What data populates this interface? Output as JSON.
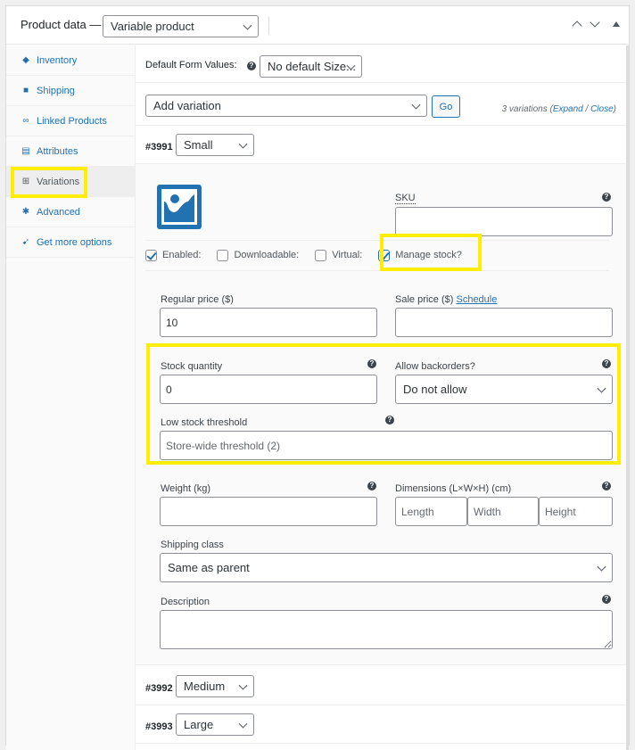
{
  "header": {
    "title": "Product data —",
    "product_type": "Variable product"
  },
  "sidebar": {
    "items": [
      {
        "label": "Inventory",
        "icon": "tag-icon"
      },
      {
        "label": "Shipping",
        "icon": "truck-icon"
      },
      {
        "label": "Linked Products",
        "icon": "link-icon"
      },
      {
        "label": "Attributes",
        "icon": "list-icon"
      },
      {
        "label": "Variations",
        "icon": "grid-icon",
        "active": true
      },
      {
        "label": "Advanced",
        "icon": "gear-icon"
      },
      {
        "label": "Get more options",
        "icon": "plugin-icon"
      }
    ]
  },
  "main": {
    "default_form_label": "Default Form Values:",
    "default_form_value": "No default Size...",
    "add_variation": "Add variation",
    "go_label": "Go",
    "variation_count": "3 variations",
    "expand_label": "Expand",
    "close_label": "Close",
    "variations": [
      {
        "id": "#3991",
        "value": "Small"
      },
      {
        "id": "#3992",
        "value": "Medium"
      },
      {
        "id": "#3993",
        "value": "Large"
      }
    ],
    "form": {
      "sku_label": "SKU",
      "sku_value": "",
      "enabled_label": "Enabled:",
      "enabled": true,
      "downloadable_label": "Downloadable:",
      "downloadable": false,
      "virtual_label": "Virtual:",
      "virtual": false,
      "manage_stock_label": "Manage stock?",
      "manage_stock": true,
      "regular_price_label": "Regular price ($)",
      "regular_price_value": "10",
      "sale_price_label": "Sale price ($)",
      "schedule_label": "Schedule",
      "sale_price_value": "",
      "stock_qty_label": "Stock quantity",
      "stock_qty_value": "0",
      "backorders_label": "Allow backorders?",
      "backorders_value": "Do not allow",
      "low_stock_label": "Low stock threshold",
      "low_stock_placeholder": "Store-wide threshold (2)",
      "weight_label": "Weight (kg)",
      "dimensions_label": "Dimensions (L×W×H) (cm)",
      "length_placeholder": "Length",
      "width_placeholder": "Width",
      "height_placeholder": "Height",
      "shipping_class_label": "Shipping class",
      "shipping_class_value": "Same as parent",
      "description_label": "Description"
    }
  },
  "highlight_color": "#ffee00",
  "accent_color": "#2271b1"
}
